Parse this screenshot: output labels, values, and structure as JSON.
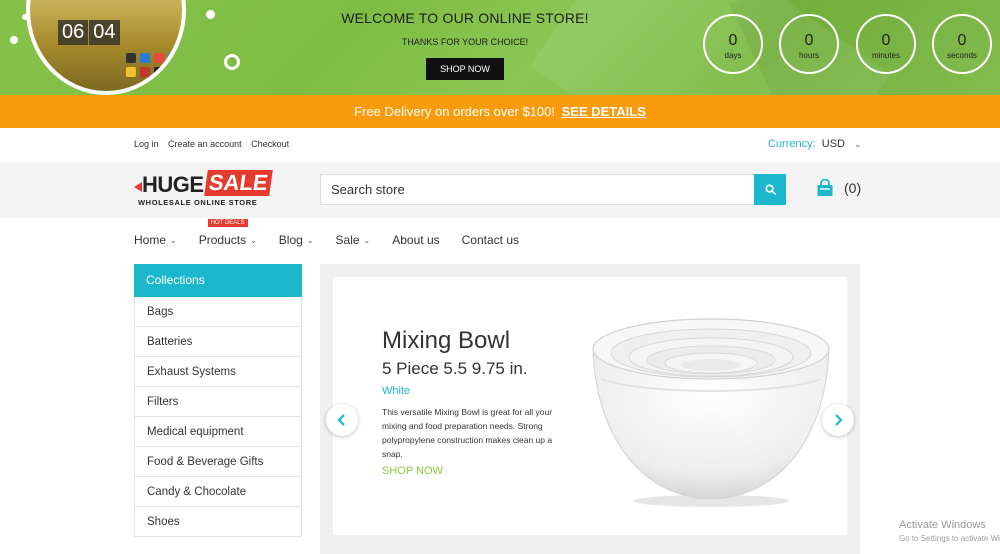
{
  "promo": {
    "title": "WELCOME TO OUR ONLINE STORE!",
    "subtitle": "THANKS FOR YOUR CHOICE!",
    "cta": "SHOP NOW",
    "phone_clock": [
      "06",
      "04"
    ],
    "countdown": [
      {
        "value": "0",
        "unit": "days"
      },
      {
        "value": "0",
        "unit": "hours"
      },
      {
        "value": "0",
        "unit": "minutes"
      },
      {
        "value": "0",
        "unit": "seconds"
      }
    ]
  },
  "delivery": {
    "text": "Free Delivery on orders over $100!",
    "link": "SEE DETAILS"
  },
  "account": {
    "login": "Log in",
    "create": "Create an account",
    "checkout": "Checkout"
  },
  "currency": {
    "label": "Currency:",
    "value": "USD"
  },
  "logo": {
    "word1": "HUGE",
    "word2": "SALE",
    "tagline": "WHOLESALE ONLINE STORE"
  },
  "search": {
    "placeholder": "Search store"
  },
  "cart": {
    "count": "(0)"
  },
  "nav": {
    "home": "Home",
    "products": "Products",
    "products_badge": "HOT DEALS",
    "blog": "Blog",
    "sale": "Sale",
    "about": "About us",
    "contact": "Contact us"
  },
  "sidebar": {
    "title": "Collections",
    "items": [
      "Bags",
      "Batteries",
      "Exhaust Systems",
      "Filters",
      "Medical equipment",
      "Food & Beverage Gifts",
      "Candy & Chocolate",
      "Shoes"
    ]
  },
  "slide": {
    "title": "Mixing Bowl",
    "subtitle": "5 Piece 5.5 9.75 in.",
    "color": "White",
    "description": "This versatile Mixing Bowl is great for all your mixing and food preparation needs. Strong polypropylene construction makes clean up a snap.",
    "cta": "SHOP NOW"
  },
  "watermark": {
    "line1": "Activate Windows",
    "line2": "Go to Settings to activate Windows."
  },
  "colors": {
    "accent": "#1cb6cd",
    "orange": "#fa9b0c",
    "green": "#8cc63f",
    "red": "#e53b2f"
  }
}
